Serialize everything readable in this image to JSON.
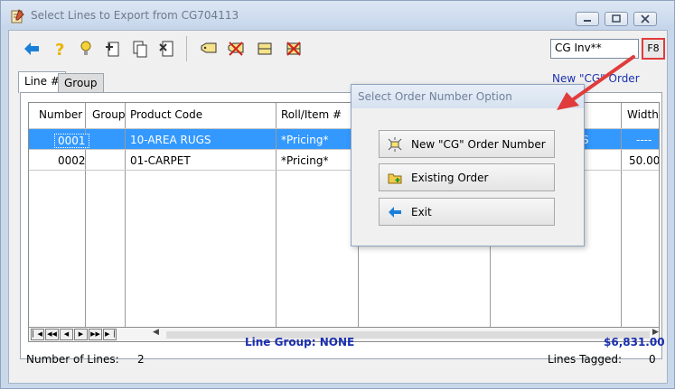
{
  "window": {
    "title": "Select Lines to Export from CG704113"
  },
  "toolbar": {
    "invoice_field_value": "CG Inv**",
    "f8_label": "F8"
  },
  "link": {
    "new_cg_order": "New \"CG\" Order"
  },
  "tabs": [
    {
      "label": "Line #",
      "active": true
    },
    {
      "label": "Group",
      "active": false
    }
  ],
  "grid": {
    "columns": [
      "Number",
      "Group",
      "Product Code",
      "Roll/Item #",
      "Width"
    ],
    "rows": [
      {
        "number": "0001",
        "group": "",
        "product_code": "10-AREA RUGS",
        "roll_item": "*Pricing*",
        "hidden_partial": "S",
        "width": "----"
      },
      {
        "number": "0002",
        "group": "",
        "product_code": "01-CARPET",
        "roll_item": "*Pricing*",
        "hidden_partial": "",
        "width": "50.00"
      }
    ],
    "selected_row": 0
  },
  "status": {
    "line_group": "Line Group: NONE",
    "total": "$6,831.00",
    "number_of_lines_label": "Number of Lines:",
    "number_of_lines_value": "2",
    "lines_tagged_label": "Lines Tagged:",
    "lines_tagged_value": "0"
  },
  "dialog": {
    "title": "Select Order Number Option",
    "buttons": [
      {
        "label": "New \"CG\" Order Number",
        "icon": "sparkle-new-icon"
      },
      {
        "label": "Existing Order",
        "icon": "folder-add-icon"
      },
      {
        "label": "Exit",
        "icon": "arrow-left-icon"
      }
    ]
  },
  "colors": {
    "selection": "#3399ff",
    "link_blue": "#1a2fb0",
    "annotation_red": "#e03c3c",
    "toolbar_blue": "#1a7fd8"
  }
}
